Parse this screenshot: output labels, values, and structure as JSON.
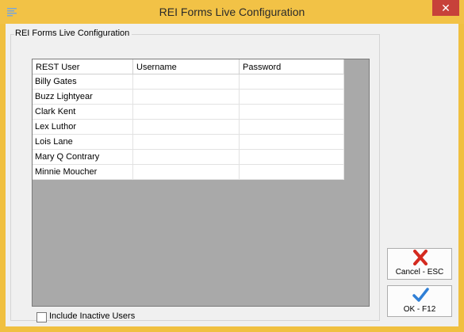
{
  "window": {
    "title": "REI Forms Live Configuration",
    "close_glyph": "✕"
  },
  "group": {
    "label": "REI Forms Live Configuration"
  },
  "grid": {
    "columns": [
      "REST User",
      "Username",
      "Password"
    ],
    "rows": [
      [
        "Billy Gates",
        "",
        ""
      ],
      [
        "Buzz Lightyear",
        "",
        ""
      ],
      [
        "Clark Kent",
        "",
        ""
      ],
      [
        "Lex Luthor",
        "",
        ""
      ],
      [
        "Lois Lane",
        "",
        ""
      ],
      [
        "Mary Q Contrary",
        "",
        ""
      ],
      [
        "Minnie Moucher",
        "",
        ""
      ]
    ],
    "selected_row": 0
  },
  "include_inactive": {
    "label": "Include Inactive Users",
    "checked": false
  },
  "buttons": {
    "cancel": {
      "label": "Cancel - ESC",
      "icon": "red-x-icon",
      "color": "#d42a1f"
    },
    "ok": {
      "label": "OK - F12",
      "icon": "blue-checkmark-icon",
      "color": "#2f7fd6"
    }
  },
  "colors": {
    "titlebar": "#f2c246",
    "close": "#c7413a",
    "grid_background": "#a9a9a9"
  }
}
